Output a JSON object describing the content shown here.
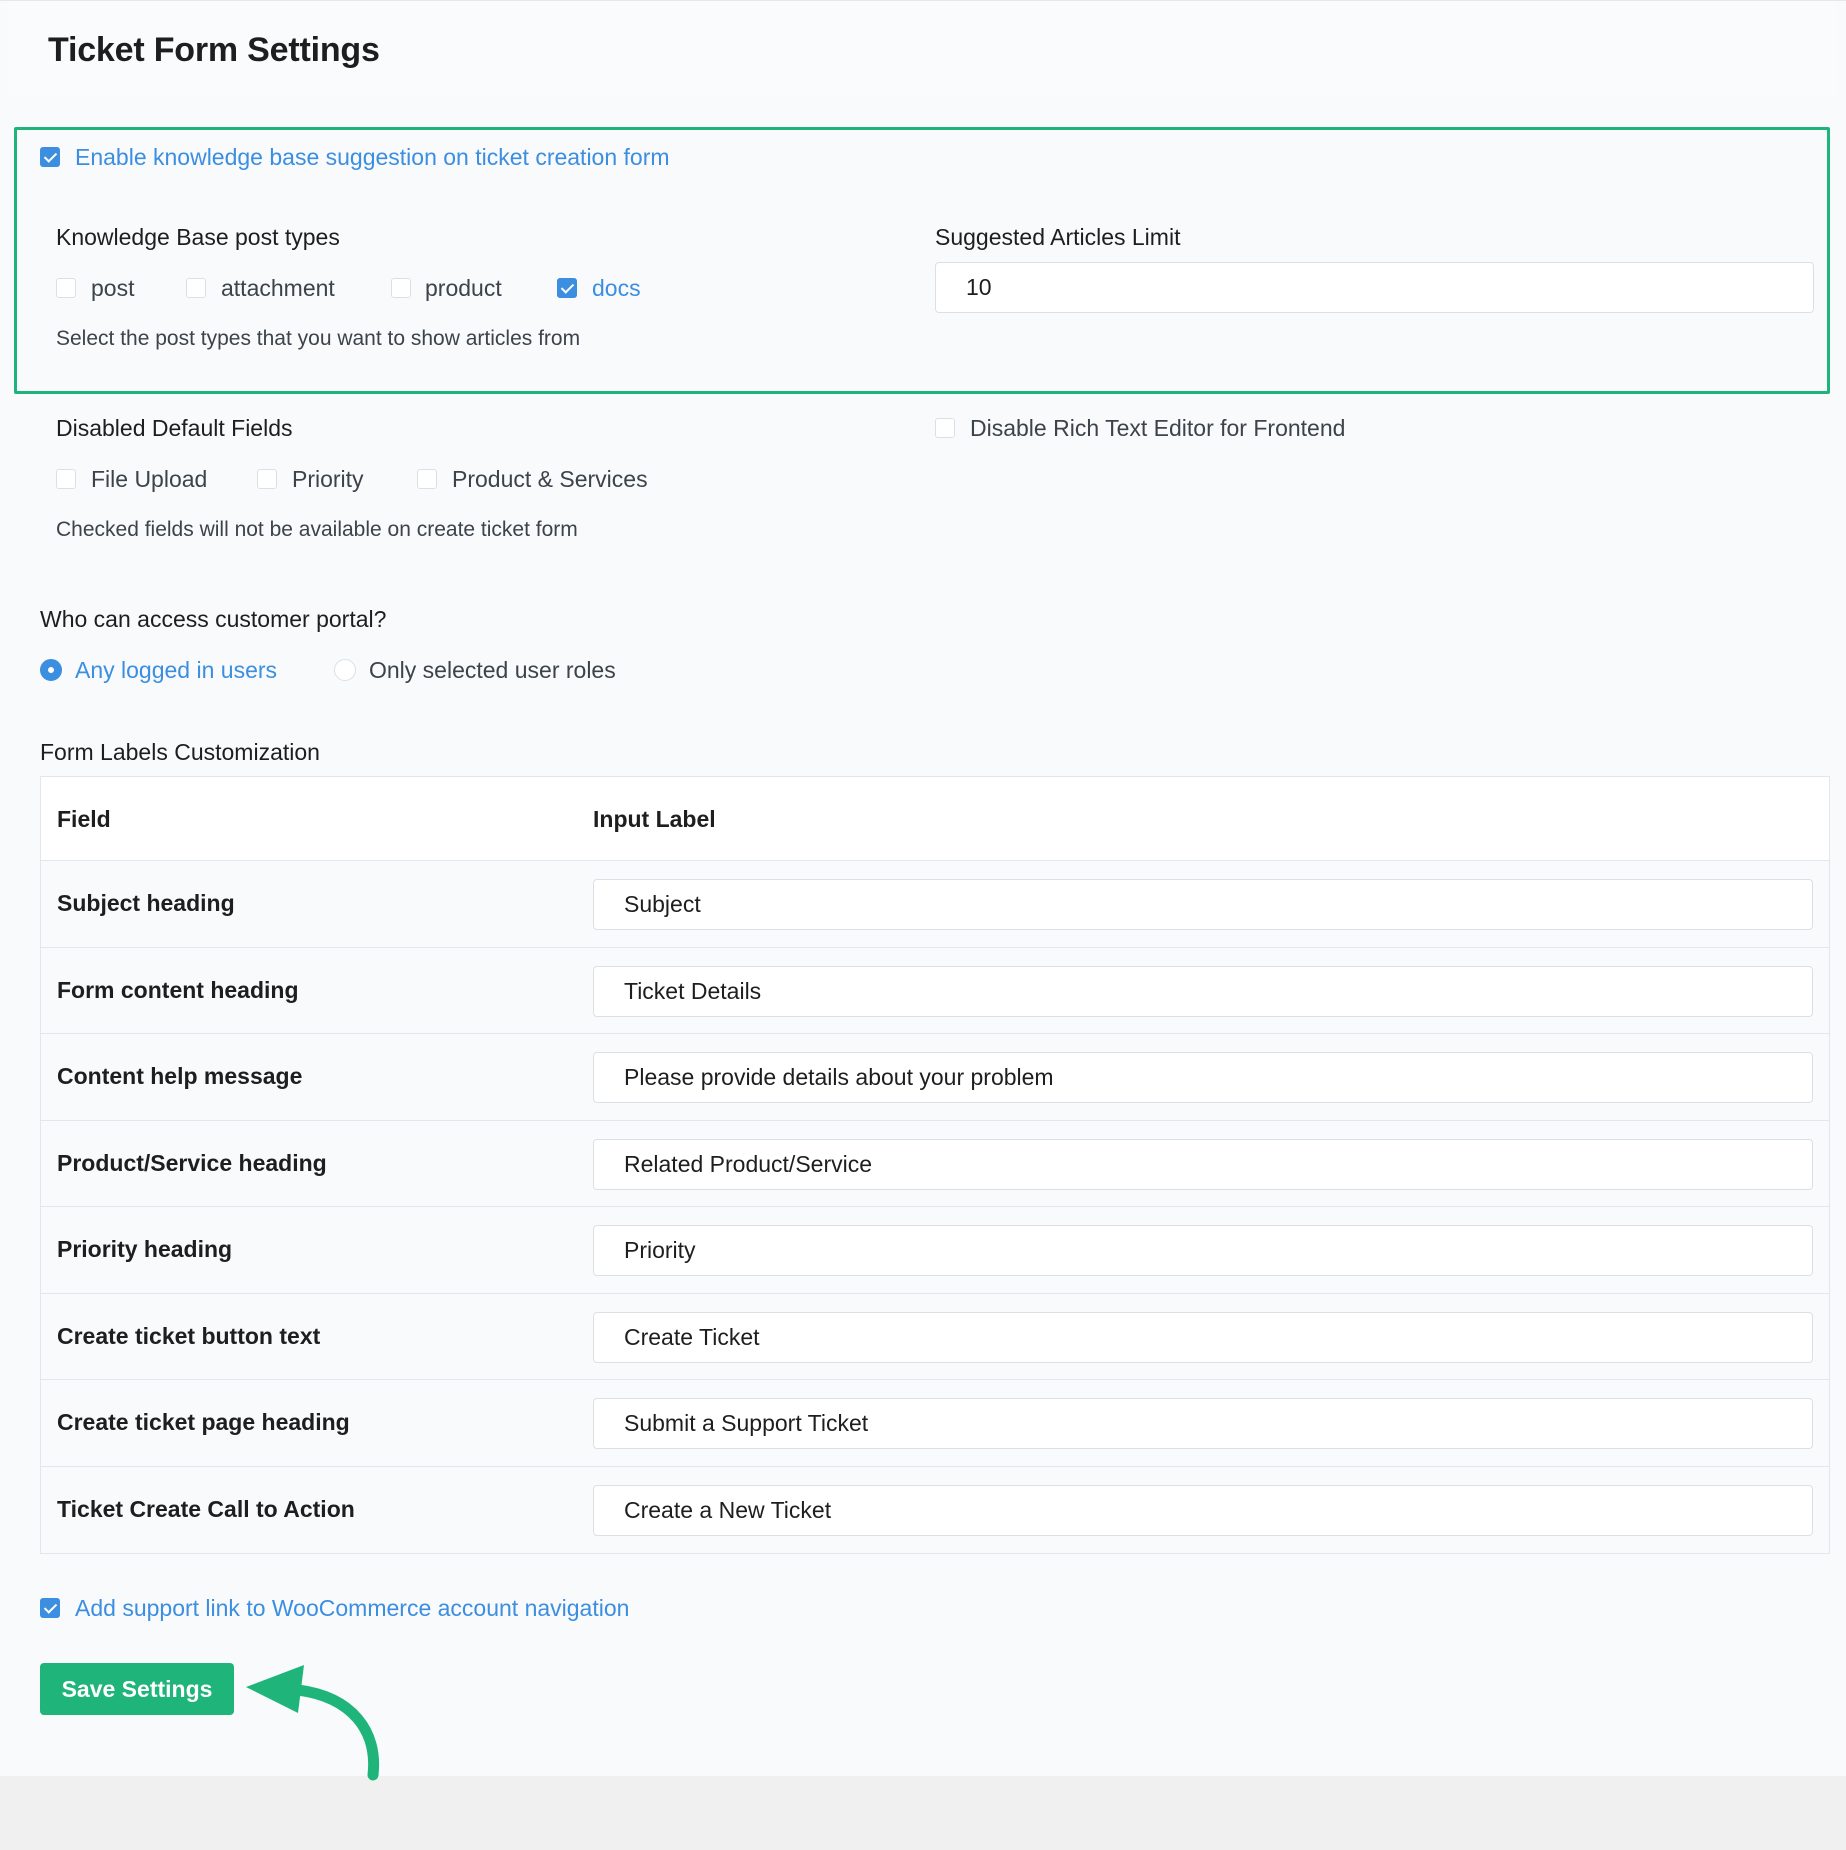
{
  "page": {
    "title": "Ticket Form Settings"
  },
  "knowledge_base": {
    "enable_label": "Enable knowledge base suggestion on ticket creation form",
    "enable_checked": true,
    "post_types_label": "Knowledge Base post types",
    "post_types": [
      {
        "label": "post",
        "checked": false
      },
      {
        "label": "attachment",
        "checked": false
      },
      {
        "label": "product",
        "checked": false
      },
      {
        "label": "docs",
        "checked": true
      }
    ],
    "post_types_help": "Select the post types that you want to show articles from",
    "limit_label": "Suggested Articles Limit",
    "limit_value": "10"
  },
  "disabled_fields": {
    "label": "Disabled Default Fields",
    "options": [
      {
        "label": "File Upload",
        "checked": false
      },
      {
        "label": "Priority",
        "checked": false
      },
      {
        "label": "Product & Services",
        "checked": false
      }
    ],
    "help": "Checked fields will not be available on create ticket form"
  },
  "rich_text": {
    "label": "Disable Rich Text Editor for Frontend",
    "checked": false
  },
  "portal_access": {
    "question": "Who can access customer portal?",
    "options": [
      {
        "label": "Any logged in users",
        "selected": true
      },
      {
        "label": "Only selected user roles",
        "selected": false
      }
    ]
  },
  "form_labels": {
    "section_title": "Form Labels Customization",
    "col_field": "Field",
    "col_input": "Input Label",
    "rows": [
      {
        "field": "Subject heading",
        "value": "Subject"
      },
      {
        "field": "Form content heading",
        "value": "Ticket Details"
      },
      {
        "field": "Content help message",
        "value": "Please provide details about your problem"
      },
      {
        "field": "Product/Service heading",
        "value": "Related Product/Service"
      },
      {
        "field": "Priority heading",
        "value": "Priority"
      },
      {
        "field": "Create ticket button text",
        "value": "Create Ticket"
      },
      {
        "field": "Create ticket page heading",
        "value": "Submit a Support Ticket"
      },
      {
        "field": "Ticket Create Call to Action",
        "value": "Create a New Ticket"
      }
    ]
  },
  "woocommerce": {
    "label": "Add support link to WooCommerce account navigation",
    "checked": true
  },
  "actions": {
    "save_label": "Save Settings"
  },
  "colors": {
    "accent_blue": "#3b8ee0",
    "brand_green": "#1fb57a",
    "arrow_icon": "arrow-pointer-icon"
  }
}
